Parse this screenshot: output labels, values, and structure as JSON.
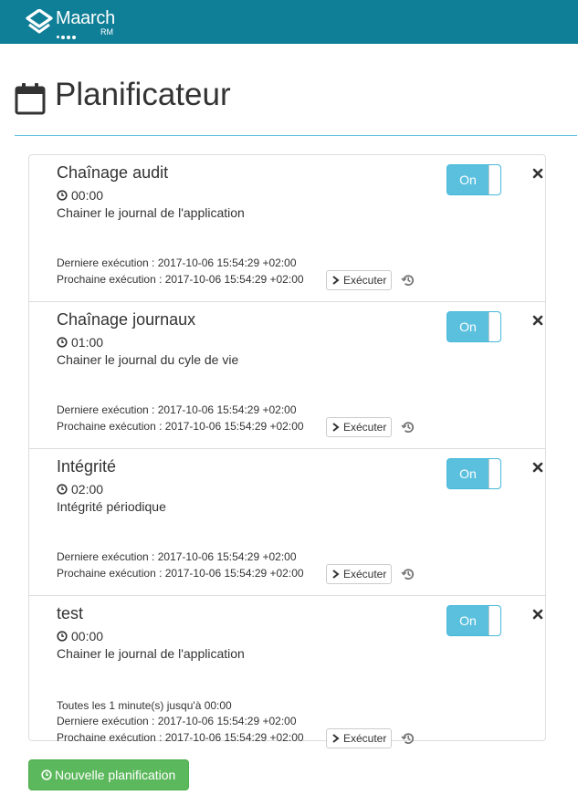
{
  "navbar": {
    "logo_text": "Maarch",
    "logo_sub": "RM",
    "brand_color": "#0f7f97"
  },
  "page": {
    "title": "Planificateur",
    "title_icon": "calendar-icon"
  },
  "tasks": [
    {
      "name": "Chaînage audit",
      "time": "00:00",
      "description": "Chainer le journal de l'application",
      "extra": "",
      "last_execution": "Derniere exécution : 2017-10-06 15:54:29 +02:00",
      "next_execution": "Prochaine exécution : 2017-10-06 15:54:29 +02:00",
      "toggle_label": "On",
      "enabled": true,
      "execute_label": "Exécuter"
    },
    {
      "name": "Chaînage journaux",
      "time": "01:00",
      "description": "Chainer le journal du cyle de vie",
      "extra": "",
      "last_execution": "Derniere exécution : 2017-10-06 15:54:29 +02:00",
      "next_execution": "Prochaine exécution : 2017-10-06 15:54:29 +02:00",
      "toggle_label": "On",
      "enabled": true,
      "execute_label": "Exécuter"
    },
    {
      "name": "Intégrité",
      "time": "02:00",
      "description": "Intégrité périodique",
      "extra": "",
      "last_execution": "Derniere exécution : 2017-10-06 15:54:29 +02:00",
      "next_execution": "Prochaine exécution : 2017-10-06 15:54:29 +02:00",
      "toggle_label": "On",
      "enabled": true,
      "execute_label": "Exécuter"
    },
    {
      "name": "test",
      "time": "00:00",
      "description": "Chainer le journal de l'application",
      "extra": "Toutes les 1 minute(s) jusqu'à 00:00",
      "last_execution": "Derniere exécution : 2017-10-06 15:54:29 +02:00",
      "next_execution": "Prochaine exécution : 2017-10-06 15:54:29 +02:00",
      "toggle_label": "On",
      "enabled": true,
      "execute_label": "Exécuter"
    }
  ],
  "new_button_label": "Nouvelle planification",
  "colors": {
    "toggle_on": "#5bc0de",
    "new_button": "#5cb85c",
    "accent_line": "#5bc0de"
  }
}
